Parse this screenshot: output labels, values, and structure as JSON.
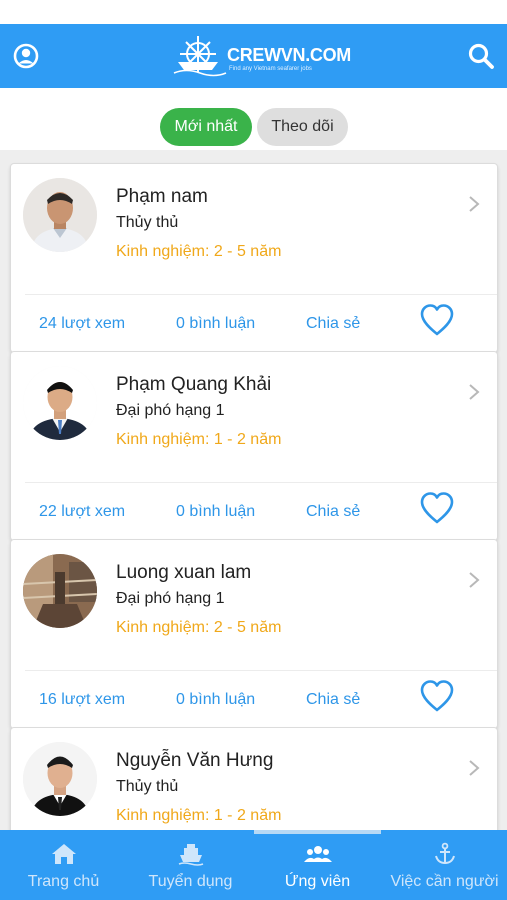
{
  "header": {
    "logo_text": "CREWVN.COM",
    "logo_tagline": "Find any Vietnam seafarer jobs"
  },
  "tabs": [
    {
      "label": "Mới nhất",
      "active": true
    },
    {
      "label": "Theo dõi",
      "active": false
    }
  ],
  "candidates": [
    {
      "name": "Phạm nam",
      "rank": "Thủy thủ",
      "experience": "Kinh nghiệm: 2 - 5 năm",
      "views": "24 lượt xem",
      "comments": "0 bình luận",
      "share": "Chia sẻ"
    },
    {
      "name": "Phạm Quang Khải",
      "rank": "Đại phó hạng 1",
      "experience": "Kinh nghiệm: 1 - 2 năm",
      "views": "22 lượt xem",
      "comments": "0 bình luận",
      "share": "Chia sẻ"
    },
    {
      "name": "Luong xuan lam",
      "rank": "Đại phó hạng 1",
      "experience": "Kinh nghiệm: 2 - 5 năm",
      "views": "16 lượt xem",
      "comments": "0 bình luận",
      "share": "Chia sẻ"
    },
    {
      "name": "Nguyễn Văn Hưng",
      "rank": "Thủy thủ",
      "experience": "Kinh nghiệm: 1 - 2 năm",
      "views": "",
      "comments": "",
      "share": ""
    }
  ],
  "bottom_nav": [
    {
      "label": "Trang chủ",
      "icon": "home-icon",
      "active": false
    },
    {
      "label": "Tuyển dụng",
      "icon": "ship-icon",
      "active": false
    },
    {
      "label": "Ứng viên",
      "icon": "group-icon",
      "active": true
    },
    {
      "label": "Việc cần người",
      "icon": "anchor-icon",
      "active": false
    }
  ],
  "colors": {
    "primary": "#2f9cf4",
    "active_tab": "#3ab34a",
    "experience_text": "#f0a81a",
    "link_text": "#2e96e8"
  }
}
